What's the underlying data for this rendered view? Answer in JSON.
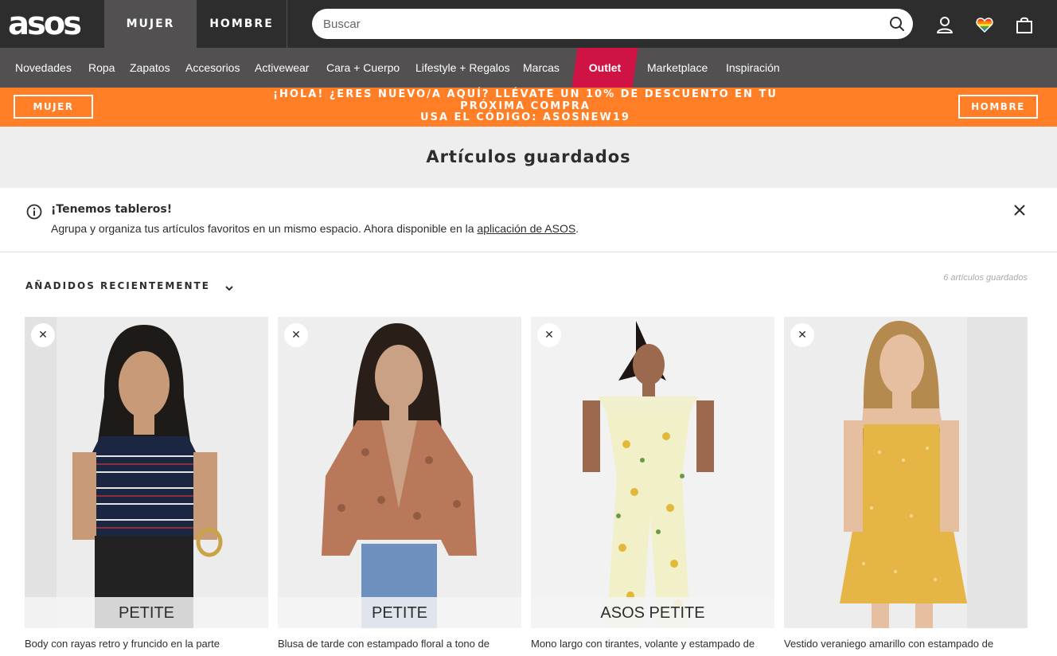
{
  "header": {
    "logo": "asos",
    "tabs": [
      "MUJER",
      "HOMBRE"
    ],
    "search": {
      "placeholder": "Buscar",
      "value": ""
    },
    "icons": [
      "search-icon",
      "account-icon",
      "heart-icon",
      "bag-icon"
    ]
  },
  "nav": {
    "items": [
      "Novedades",
      "Ropa",
      "Zapatos",
      "Accesorios",
      "Activewear",
      "Cara + Cuerpo",
      "Lifestyle + Regalos",
      "Marcas",
      "Outlet",
      "Marketplace",
      "Inspiración"
    ],
    "outlet_color": "#d01345"
  },
  "promo": {
    "left_button": "MUJER",
    "right_button": "HOMBRE",
    "line1": "¡HOLA! ¿ERES NUEVO/A AQUÍ? LLÉVATE UN 10% DE DESCUENTO EN TU",
    "line2": "PRÓXIMA COMPRA",
    "line3": "USA EL CÓDIGO: ASOSNEW19",
    "color": "#ff7e26"
  },
  "page": {
    "title": "Artículos guardados"
  },
  "notice": {
    "title": "¡Tenemos tableros!",
    "text": "Agrupa y organiza tus artículos favoritos en un mismo espacio. Ahora disponible en la ",
    "link": "aplicación de ASOS",
    "suffix": "."
  },
  "sort": {
    "label": "AÑADIDOS RECIENTEMENTE"
  },
  "count": "6 artículos guardados",
  "products": [
    {
      "badge": "PETITE",
      "description": "Body con rayas retro y fruncido en la parte"
    },
    {
      "badge": "PETITE",
      "description": "Blusa de tarde con estampado floral a tono de"
    },
    {
      "badge": "ASOS PETITE",
      "description": "Mono largo con tirantes, volante y estampado de"
    },
    {
      "badge": "",
      "description": "Vestido veraniego amarillo con estampado de"
    }
  ],
  "colors": {
    "header_bg": "#2d2d2d",
    "nav_bg": "#525050"
  }
}
